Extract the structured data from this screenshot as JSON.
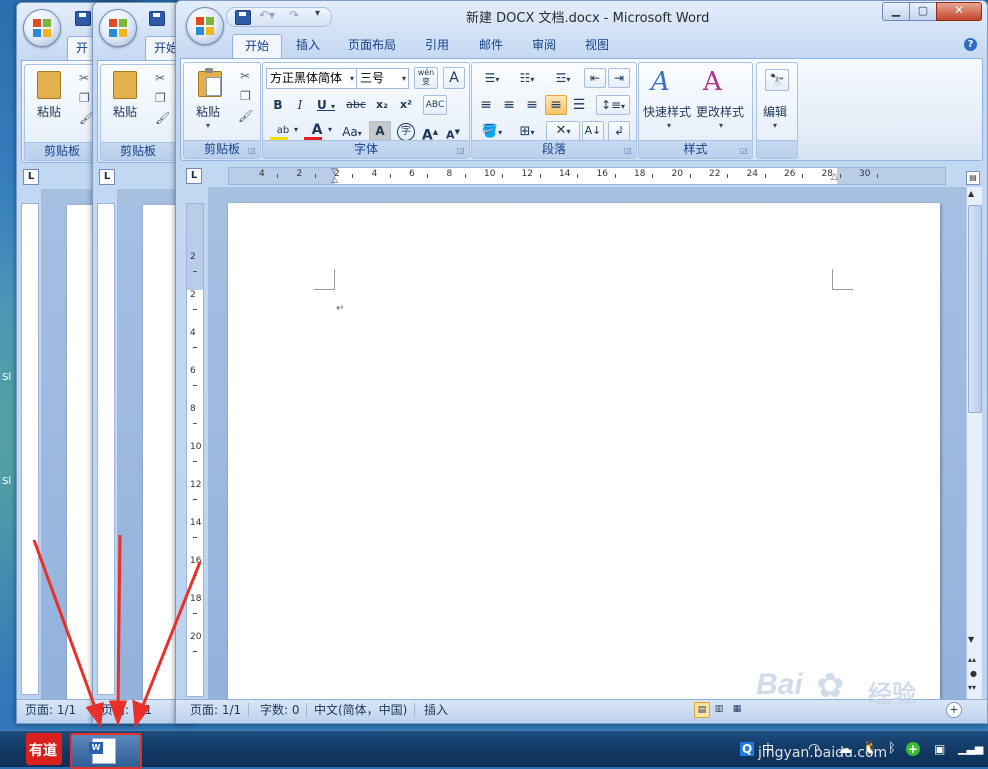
{
  "desktop": {
    "labels": [
      "Sl",
      "Sl"
    ]
  },
  "windows": {
    "back2": {
      "tab_active": "开",
      "paste_label": "粘贴",
      "group_clipboard": "剪贴板",
      "status_page": "页面: 1/1"
    },
    "back1": {
      "tab_active": "开始",
      "paste_label": "粘贴",
      "group_clipboard": "剪贴板",
      "status_page": "页面: 1/1"
    },
    "front": {
      "title": "新建 DOCX 文档.docx - Microsoft Word",
      "tabs": [
        "开始",
        "插入",
        "页面布局",
        "引用",
        "邮件",
        "审阅",
        "视图"
      ],
      "groups": {
        "clipboard": {
          "label": "剪贴板",
          "paste": "粘贴"
        },
        "font": {
          "label": "字体",
          "font_name": "方正黑体简体",
          "font_size": "三号",
          "wen": "wén\n变",
          "bold": "B",
          "italic": "I",
          "underline": "U",
          "strike": "abc",
          "sub": "x₂",
          "sup": "x²",
          "aa": "Aa",
          "a_big": "A",
          "a_grow": "A",
          "a_shrink": "A"
        },
        "paragraph": {
          "label": "段落"
        },
        "styles": {
          "label": "样式",
          "quick": "快速样式",
          "change": "更改样式"
        },
        "editing": {
          "label": "编辑"
        }
      },
      "ruler_numbers": [
        "4",
        "2",
        "2",
        "4",
        "6",
        "8",
        "10",
        "12",
        "14",
        "16",
        "18",
        "20",
        "22",
        "24",
        "26",
        "28",
        "30"
      ],
      "vruler_numbers": [
        "2",
        "2",
        "4",
        "6",
        "8",
        "10",
        "12",
        "14",
        "16",
        "18",
        "20"
      ],
      "paragraph_mark": "↵",
      "status": {
        "page": "页面: 1/1",
        "words": "字数: 0",
        "language": "中文(简体，中国)",
        "mode": "插入"
      }
    }
  },
  "taskbar": {
    "youdao_label": "有道",
    "tray": {
      "ime": "中",
      "watermark_brand": "Bai",
      "watermark_cn": "经验",
      "watermark_url": "jingyan.baidu.com"
    }
  },
  "colors": {
    "highlight": "#f5e100",
    "font_color": "#e81f1f",
    "arrow": "#e8302a",
    "youdao": "#d9201c"
  }
}
